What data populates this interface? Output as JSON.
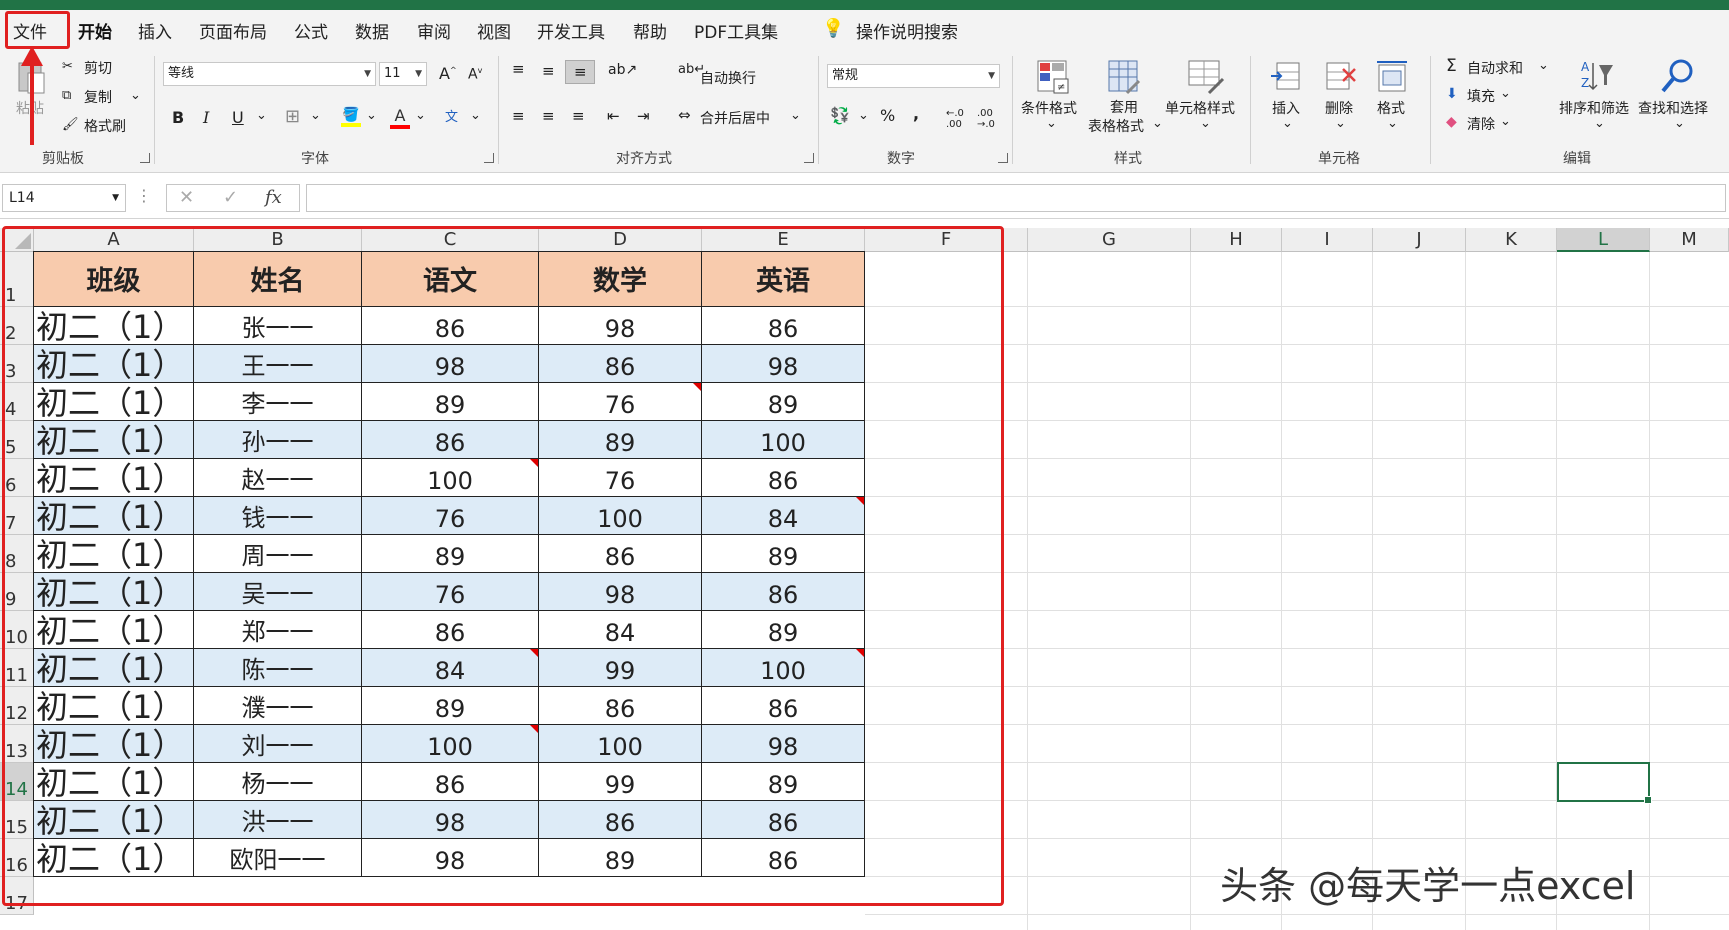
{
  "menu": {
    "file": "文件",
    "tabs": [
      "开始",
      "插入",
      "页面布局",
      "公式",
      "数据",
      "审阅",
      "视图",
      "开发工具",
      "帮助",
      "PDF工具集"
    ],
    "search": "操作说明搜索"
  },
  "ribbon": {
    "clipboard": {
      "paste": "粘贴",
      "cut": "剪切",
      "copy": "复制",
      "format_painter": "格式刷",
      "label": "剪贴板"
    },
    "font": {
      "name": "等线",
      "size": "11",
      "label": "字体"
    },
    "alignment": {
      "wrap": "自动换行",
      "merge": "合并后居中",
      "label": "对齐方式"
    },
    "number": {
      "format": "常规",
      "label": "数字"
    },
    "styles": {
      "conditional": "条件格式",
      "table_l1": "套用",
      "table_l2": "表格格式",
      "cell_styles": "单元格样式",
      "label": "样式"
    },
    "cells": {
      "insert": "插入",
      "delete": "删除",
      "format": "格式",
      "label": "单元格"
    },
    "editing": {
      "autosum": "自动求和",
      "fill": "填充",
      "clear": "清除",
      "sort": "排序和筛选",
      "find": "查找和选择",
      "label": "编辑"
    }
  },
  "formula_bar": {
    "name_box": "L14",
    "fx": "fx"
  },
  "columns": [
    "A",
    "B",
    "C",
    "D",
    "E",
    "F",
    "G",
    "H",
    "I",
    "J",
    "K",
    "L",
    "M"
  ],
  "rows": [
    "1",
    "2",
    "3",
    "4",
    "5",
    "6",
    "7",
    "8",
    "9",
    "10",
    "11",
    "12",
    "13",
    "14",
    "15",
    "16",
    "17"
  ],
  "table": {
    "headers": [
      "班级",
      "姓名",
      "语文",
      "数学",
      "英语"
    ],
    "rows": [
      [
        "初二（1）",
        "张一一",
        "86",
        "98",
        "86"
      ],
      [
        "初二（1）",
        "王一一",
        "98",
        "86",
        "98"
      ],
      [
        "初二（1）",
        "李一一",
        "89",
        "76",
        "89"
      ],
      [
        "初二（1）",
        "孙一一",
        "86",
        "89",
        "100"
      ],
      [
        "初二（1）",
        "赵一一",
        "100",
        "76",
        "86"
      ],
      [
        "初二（1）",
        "钱一一",
        "76",
        "100",
        "84"
      ],
      [
        "初二（1）",
        "周一一",
        "89",
        "86",
        "89"
      ],
      [
        "初二（1）",
        "吴一一",
        "76",
        "98",
        "86"
      ],
      [
        "初二（1）",
        "郑一一",
        "86",
        "84",
        "89"
      ],
      [
        "初二（1）",
        "陈一一",
        "84",
        "99",
        "100"
      ],
      [
        "初二（1）",
        "濮一一",
        "89",
        "86",
        "86"
      ],
      [
        "初二（1）",
        "刘一一",
        "100",
        "100",
        "98"
      ],
      [
        "初二（1）",
        "杨一一",
        "86",
        "99",
        "89"
      ],
      [
        "初二（1）",
        "洪一一",
        "98",
        "86",
        "86"
      ],
      [
        "初二（1）",
        "欧阳一一",
        "98",
        "89",
        "86"
      ]
    ]
  },
  "colors": {
    "accent": "#217346",
    "header_fill": "#f8cbad",
    "band_fill": "#ddebf7",
    "annotation": "#e02020"
  },
  "watermark": "头条 @每天学一点excel"
}
